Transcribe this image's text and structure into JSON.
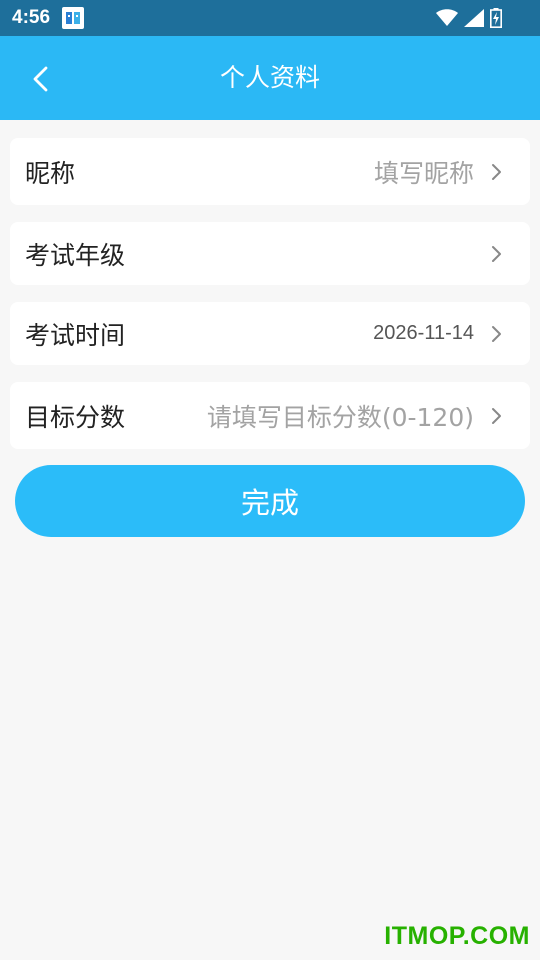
{
  "status_bar": {
    "time": "4:56",
    "icons": [
      "app-notification-icon",
      "wifi-icon",
      "cell-signal-icon",
      "battery-charging-icon"
    ]
  },
  "header": {
    "title": "个人资料",
    "back_icon": "chevron-left-icon"
  },
  "form": {
    "rows": [
      {
        "label": "昵称",
        "value": "填写昵称",
        "value_is_placeholder": true
      },
      {
        "label": "考试年级",
        "value": "",
        "value_is_placeholder": false
      },
      {
        "label": "考试时间",
        "value": "2026-11-14",
        "value_is_placeholder": false
      },
      {
        "label": "目标分数",
        "value": "请填写目标分数(0-120)",
        "value_is_placeholder": true
      }
    ]
  },
  "submit": {
    "label": "完成"
  },
  "watermark": "ITMOP.COM",
  "colors": {
    "status_bar": "#1e6f9b",
    "header": "#2bb8f5",
    "button": "#2bbcf9",
    "page_bg": "#f7f7f7",
    "watermark": "#27b100"
  }
}
